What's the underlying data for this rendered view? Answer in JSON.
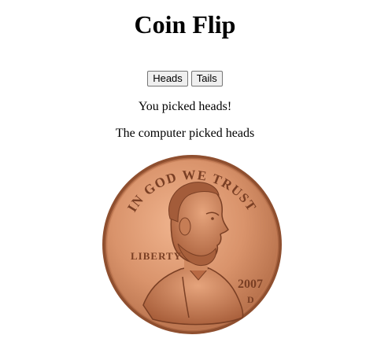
{
  "header": {
    "title": "Coin Flip"
  },
  "controls": {
    "heads_label": "Heads",
    "tails_label": "Tails"
  },
  "result": {
    "user_message": "You picked heads!",
    "computer_message": "The computer picked heads"
  },
  "coin": {
    "rim_text": "IN GOD WE TRUST",
    "left_text": "LIBERTY",
    "year": "2007",
    "mint_mark": "D",
    "colors": {
      "face": "#d9936b",
      "rim": "#a35c3a",
      "shadow": "#7a3f24"
    }
  }
}
